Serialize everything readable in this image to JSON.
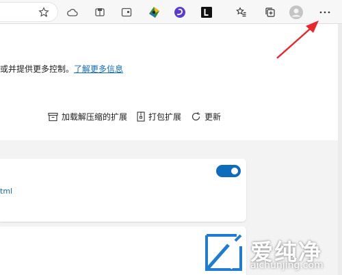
{
  "intro": {
    "text": "或并提供更多控制。",
    "link": "了解更多信息"
  },
  "actions": {
    "load_unpacked": "加载解压缩的扩展",
    "pack": "打包扩展",
    "update": "更新"
  },
  "card": {
    "link_fragment": "tml",
    "toggle_on": true
  },
  "watermark": {
    "brand": "爱纯净",
    "url": "aichunjing.com"
  },
  "colors": {
    "accent": "#0f6cbd",
    "arrow": "#e8262c"
  },
  "icons": [
    "favorite-star-icon",
    "cloud-icon",
    "extension-store-icon",
    "media-icon",
    "paint-icon",
    "swirl-app-icon",
    "letter-l-app-icon",
    "favorites-icon",
    "collections-icon",
    "profile-icon",
    "more-icon"
  ]
}
